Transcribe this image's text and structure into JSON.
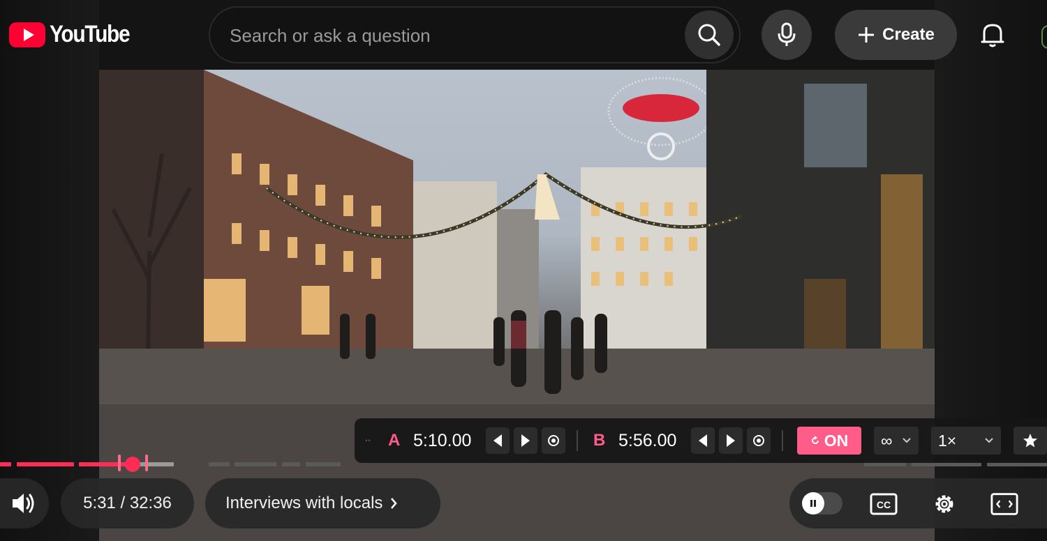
{
  "header": {
    "logo_text": "YouTube",
    "search_placeholder": "Search or ask a question",
    "create_label": "Create"
  },
  "player": {
    "time_display": "5:31 / 32:36",
    "chapter_label": "Interviews with locals",
    "progress_played_fraction": 0.17
  },
  "ab_loop": {
    "dots": "··",
    "a_label": "A",
    "a_time": "5:10.00",
    "b_label": "B",
    "b_time": "5:56.00",
    "toggle_label": "ON",
    "repeat_label": "∞",
    "speed_label": "1×"
  },
  "colors": {
    "accent": "#ff5c8a",
    "progress": "#ff2d55",
    "brand": "#ff0033"
  }
}
